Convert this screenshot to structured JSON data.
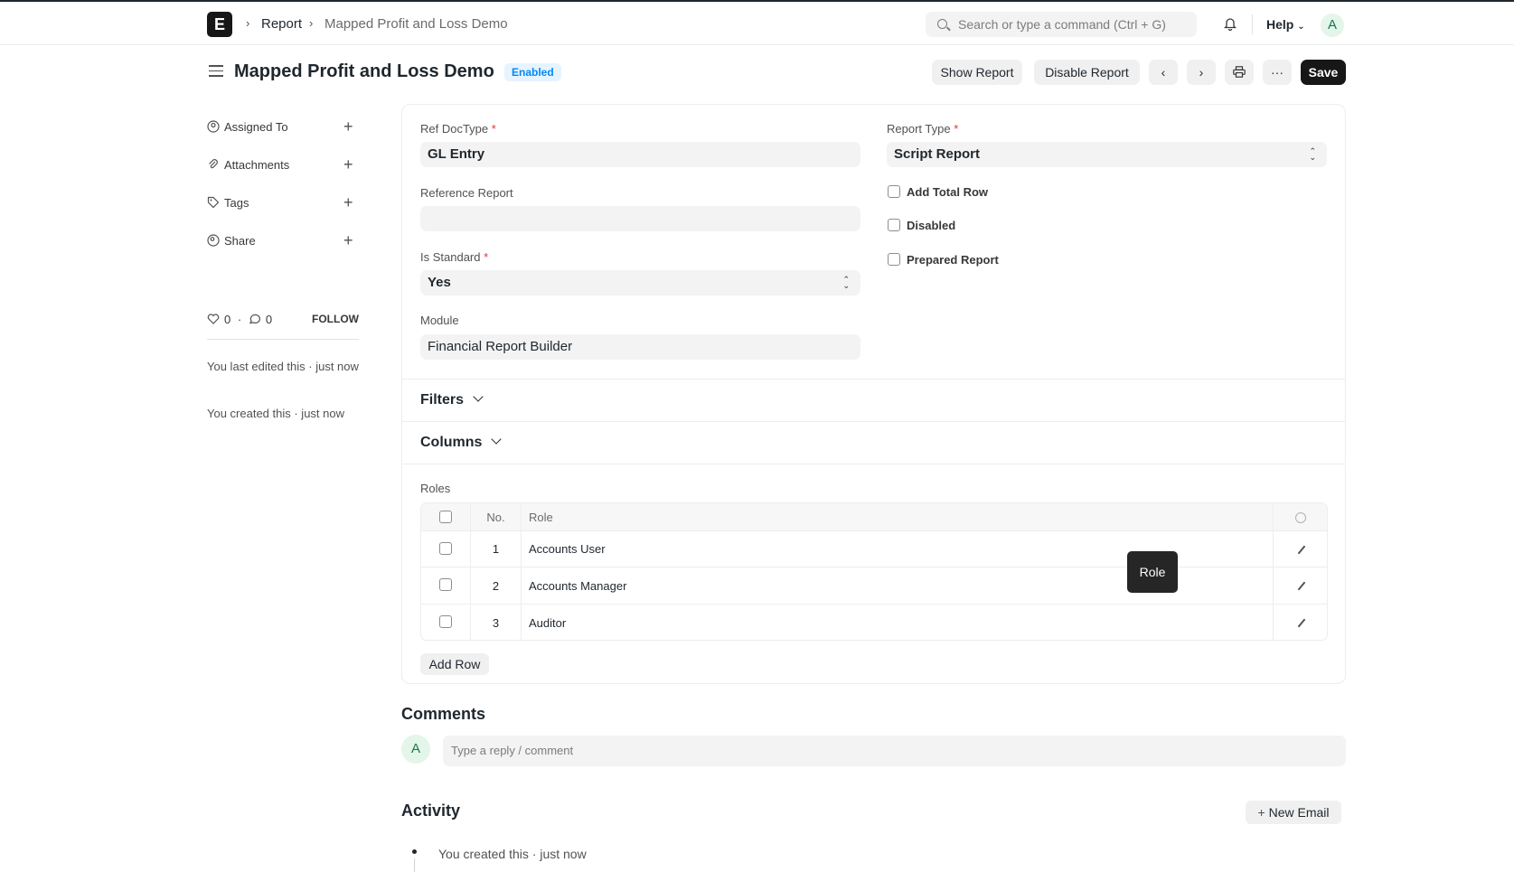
{
  "navbar": {
    "logo": "E",
    "breadcrumbs": [
      "Report",
      "Mapped Profit and Loss Demo"
    ],
    "search_placeholder": "Search or type a command (Ctrl + G)",
    "help_label": "Help",
    "avatar_initial": "A"
  },
  "page": {
    "title": "Mapped Profit and Loss Demo",
    "status_badge": "Enabled",
    "actions": {
      "show_report": "Show Report",
      "disable_report": "Disable Report",
      "more": "···",
      "save": "Save"
    }
  },
  "sidebar": {
    "items": [
      {
        "label": "Assigned To",
        "icon": "assign-icon"
      },
      {
        "label": "Attachments",
        "icon": "paperclip-icon"
      },
      {
        "label": "Tags",
        "icon": "tag-icon"
      },
      {
        "label": "Share",
        "icon": "share-icon"
      }
    ],
    "likes": "0",
    "comments": "0",
    "follow_label": "FOLLOW",
    "last_edited": "You last edited this · just now",
    "created": "You created this · just now"
  },
  "form": {
    "ref_doctype": {
      "label": "Ref DocType",
      "value": "GL Entry"
    },
    "report_type": {
      "label": "Report Type",
      "value": "Script Report"
    },
    "reference_report": {
      "label": "Reference Report",
      "value": ""
    },
    "add_total_row": {
      "label": "Add Total Row",
      "checked": false
    },
    "disabled": {
      "label": "Disabled",
      "checked": false
    },
    "prepared_report": {
      "label": "Prepared Report",
      "checked": false
    },
    "is_standard": {
      "label": "Is Standard",
      "value": "Yes"
    },
    "module": {
      "label": "Module",
      "value": "Financial Report Builder"
    }
  },
  "sections": {
    "filters": "Filters",
    "columns": "Columns"
  },
  "roles": {
    "label": "Roles",
    "headers": {
      "no": "No.",
      "role": "Role"
    },
    "rows": [
      {
        "no": "1",
        "role": "Accounts User"
      },
      {
        "no": "2",
        "role": "Accounts Manager"
      },
      {
        "no": "3",
        "role": "Auditor"
      }
    ],
    "tooltip": "Role",
    "add_row": "Add Row"
  },
  "comments": {
    "title": "Comments",
    "avatar_initial": "A",
    "placeholder": "Type a reply / comment"
  },
  "activity": {
    "title": "Activity",
    "new_email": "New Email",
    "new_email_icon": "+",
    "items": [
      "You created this · just now"
    ]
  }
}
